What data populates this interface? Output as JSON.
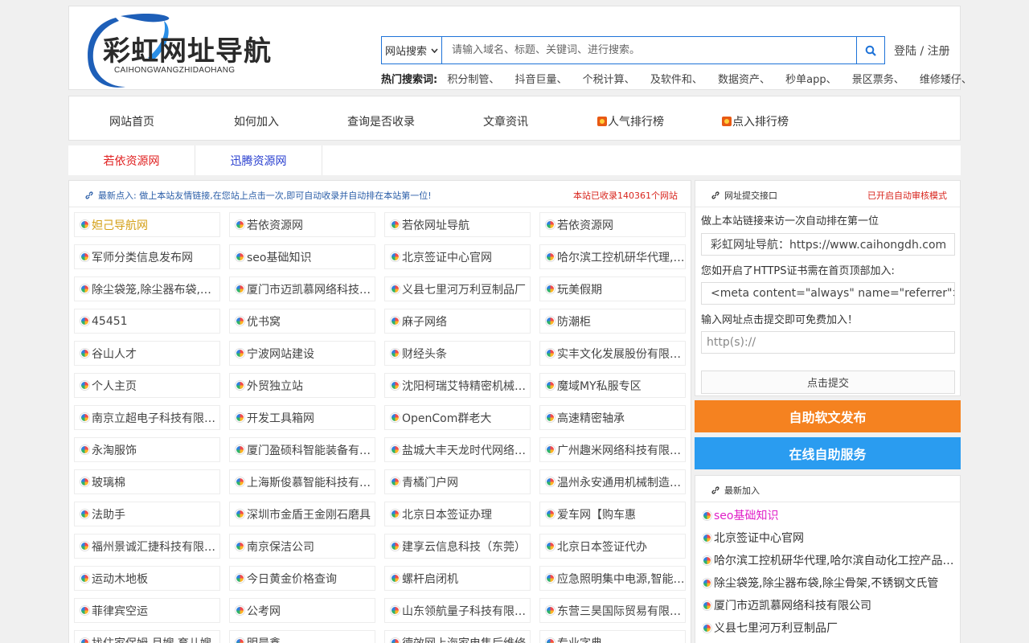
{
  "logo": {
    "title": "彩虹网址导航",
    "subtitle": "CAIHONGWANGZHIDAOHANG"
  },
  "search": {
    "select_value": "网站搜索",
    "placeholder": "请输入域名、标题、关键词、进行搜索。"
  },
  "login": {
    "label": "登陆 / 注册"
  },
  "hot": {
    "label": "热门搜索词:",
    "keywords": [
      "积分制管、",
      "抖音巨量、",
      "个税计算、",
      "及软件和、",
      "数据资产、",
      "秒单app、",
      "景区票务、",
      "维修矮仔、"
    ]
  },
  "nav": {
    "items": [
      "网站首页",
      "如何加入",
      "查询是否收录",
      "文章资讯",
      "人气排行榜",
      "点入排行榜"
    ]
  },
  "friends": [
    {
      "label": "若依资源网",
      "color": "#e02020"
    },
    {
      "label": "迅腾资源网",
      "color": "#2a40d0"
    }
  ],
  "main": {
    "notice": "最新点入: 做上本站友情链接,在您站上点击一次,即可自动收录并自动排在本站第一位!",
    "count": "本站已收录140361个网站",
    "sites": [
      [
        "妲己导航网",
        "若依资源网",
        "若依网址导航",
        "若依资源网"
      ],
      [
        "军师分类信息发布网",
        "seo基础知识",
        "北京签证中心官网",
        "哈尔滨工控机研华代理,哈尔滨自动化"
      ],
      [
        "除尘袋笼,除尘器布袋,除尘骨架",
        "厦门市迈凯慕网络科技有限公司",
        "义县七里河万利豆制品厂",
        "玩美假期"
      ],
      [
        "45451",
        "优书窝",
        "麻子网络",
        "防潮柜"
      ],
      [
        "谷山人才",
        "宁波网站建设",
        "财经头条",
        "实丰文化发展股份有限公司"
      ],
      [
        "个人主页",
        "外贸独立站",
        "沈阳柯瑞艾特精密机械有限公司",
        "魔域MY私服专区"
      ],
      [
        "南京立超电子科技有限公司",
        "开发工具箱网",
        "OpenCom群老大",
        "高速精密轴承"
      ],
      [
        "永淘服饰",
        "厦门盈硕科智能装备有限公司",
        "盐城大丰天龙时代网络科技",
        "广州趣米网络科技有限公司"
      ],
      [
        "玻璃棉",
        "上海斯俊慕智能科技有限公司",
        "青橘门户网",
        "温州永安通用机械制造有限公司"
      ],
      [
        "法助手",
        "深圳市金盾王金刚石磨具",
        "北京日本签证办理",
        "爱车网【购车惠"
      ],
      [
        "福州景诚汇捷科技有限公司",
        "南京保洁公司",
        "建享云信息科技（东莞）",
        "北京日本签证代办"
      ],
      [
        "运动木地板",
        "今日黄金价格查询",
        "螺杆启闭机",
        "应急照明集中电源,智能疏散"
      ],
      [
        "菲律宾空运",
        "公考网",
        "山东领航量子科技有限公司",
        "东营三昊国际贸易有限公司"
      ],
      [
        "找住家保姆,月嫂,育儿嫂",
        "明晨鑫",
        "德效网上海家电售后维修",
        "专业字典"
      ]
    ],
    "first_color": "#d4a017"
  },
  "submit": {
    "title": "网址提交接口",
    "mode": "已开启自动审核模式",
    "line1": "做上本站链接来访一次自动排在第一位",
    "code1": "彩虹网址导航：https://www.caihongdh.com",
    "line2": "您如开启了HTTPS证书需在首页顶部加入:",
    "code2": "<meta content=\"always\" name=\"referrer\">",
    "line3": "输入网址点击提交即可免费加入！",
    "url_placeholder": "http(s)://",
    "submit_label": "点击提交"
  },
  "buttons": {
    "article": "自助软文发布",
    "service": "在线自助服务"
  },
  "latest": {
    "title": "最新加入",
    "items": [
      "seo基础知识",
      "北京签证中心官网",
      "哈尔滨工控机研华代理,哈尔滨自动化工控产品销售",
      "除尘袋笼,除尘器布袋,除尘骨架,不锈钢文氏管",
      "厦门市迈凯慕网络科技有限公司",
      "义县七里河万利豆制品厂"
    ],
    "first_color": "#e020c8"
  }
}
